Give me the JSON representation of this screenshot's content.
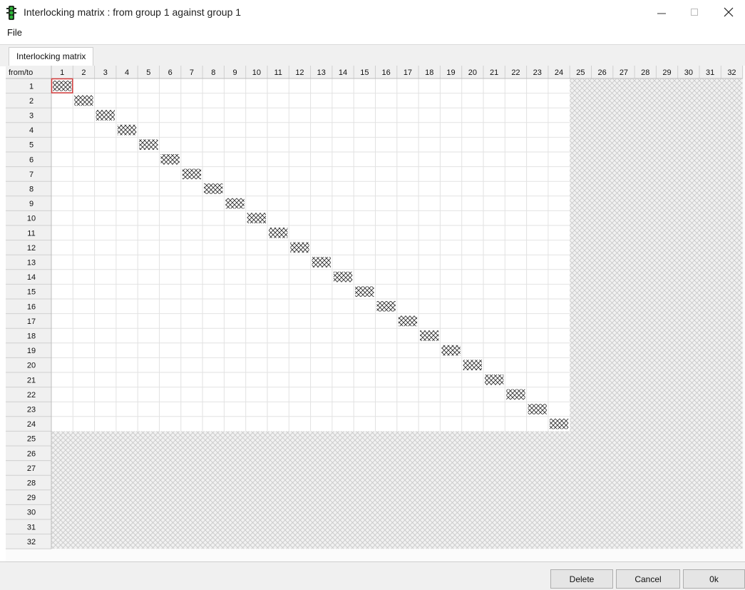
{
  "window": {
    "title": "Interlocking matrix : from group  1 against group  1",
    "icon": "traffic-light-icon"
  },
  "window_controls": {
    "minimize_icon": "minimize-icon",
    "maximize_icon": "maximize-icon",
    "close_icon": "close-icon"
  },
  "menu": {
    "file_label": "File"
  },
  "tabs": [
    {
      "label": "Interlocking matrix",
      "active": true
    }
  ],
  "matrix": {
    "corner_label": "from/to",
    "columns": [
      "1",
      "2",
      "3",
      "4",
      "5",
      "6",
      "7",
      "8",
      "9",
      "10",
      "11",
      "12",
      "13",
      "14",
      "15",
      "16",
      "17",
      "18",
      "19",
      "20",
      "21",
      "22",
      "23",
      "24",
      "25",
      "26",
      "27",
      "28",
      "29",
      "30",
      "31",
      "32"
    ],
    "rows": [
      "1",
      "2",
      "3",
      "4",
      "5",
      "6",
      "7",
      "8",
      "9",
      "10",
      "11",
      "12",
      "13",
      "14",
      "15",
      "16",
      "17",
      "18",
      "19",
      "20",
      "21",
      "22",
      "23",
      "24",
      "25",
      "26",
      "27",
      "28",
      "29",
      "30",
      "31",
      "32"
    ],
    "active_group_size": 24,
    "diagonal_marked": true,
    "selected_cell": {
      "row": "1",
      "column": "1"
    }
  },
  "buttons": {
    "delete_label": "Delete",
    "cancel_label": "Cancel",
    "ok_label": "0k"
  },
  "colors": {
    "selection": "#d23a3a",
    "header_bg": "#f0f0f0",
    "disabled_hatch": "#c8c8c8",
    "grid_line": "#e2e2e2"
  }
}
